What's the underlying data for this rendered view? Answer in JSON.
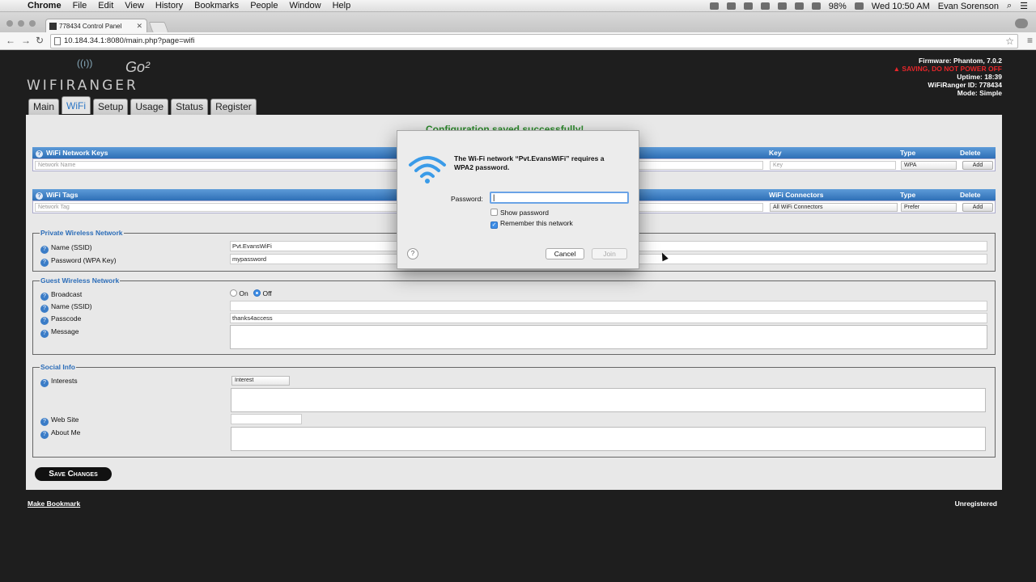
{
  "menubar": {
    "app": "Chrome",
    "items": [
      "File",
      "Edit",
      "View",
      "History",
      "Bookmarks",
      "People",
      "Window",
      "Help"
    ],
    "battery": "98%",
    "clock": "Wed 10:50 AM",
    "user": "Evan Sorenson"
  },
  "browser": {
    "tab_title": "778434 Control Panel",
    "url": "10.184.34.1:8080/main.php?page=wifi"
  },
  "header": {
    "logo_text": "WIFIRANGER",
    "logo_model": "Go²",
    "firmware": "Firmware: Phantom, 7.0.2",
    "warning": "SAVING, DO NOT POWER OFF",
    "uptime": "Uptime: 18:39",
    "ranger_id": "WiFiRanger ID: 778434",
    "mode": "Mode: Simple"
  },
  "nav": [
    "Main",
    "WiFi",
    "Setup",
    "Usage",
    "Status",
    "Register"
  ],
  "content": {
    "confirmation": "Configuration saved successfully!",
    "network_keys": {
      "title": "WiFi Network Keys",
      "col_key": "Key",
      "col_type": "Type",
      "col_delete": "Delete",
      "name_placeholder": "Network Name",
      "key_placeholder": "Key",
      "type_value": "WPA",
      "add_label": "Add"
    },
    "wifi_tags": {
      "title": "WiFi Tags",
      "col_connectors": "WiFi Connectors",
      "col_type": "Type",
      "col_delete": "Delete",
      "tag_placeholder": "Network Tag",
      "connector_value": "All WiFi Connectors",
      "type_value": "Prefer",
      "add_label": "Add"
    },
    "private": {
      "legend": "Private Wireless Network",
      "ssid_label": "Name (SSID)",
      "ssid_value": "Pvt.EvansWiFi",
      "key_label": "Password (WPA Key)",
      "key_value": "mypassword"
    },
    "guest": {
      "legend": "Guest Wireless Network",
      "broadcast_label": "Broadcast",
      "on_label": "On",
      "off_label": "Off",
      "ssid_label": "Name (SSID)",
      "passcode_label": "Passcode",
      "passcode_value": "thanks4access",
      "message_label": "Message"
    },
    "social": {
      "legend": "Social Info",
      "interests_label": "Interests",
      "interest_select": "Interest",
      "website_label": "Web Site",
      "about_label": "About Me"
    },
    "save_label": "Save Changes"
  },
  "footer": {
    "bookmark": "Make Bookmark",
    "status": "Unregistered"
  },
  "dialog": {
    "message": "The Wi-Fi network “Pvt.EvansWiFi” requires a WPA2 password.",
    "password_label": "Password:",
    "password_value": "",
    "show_password": "Show password",
    "show_password_checked": false,
    "remember": "Remember this network",
    "remember_checked": true,
    "cancel": "Cancel",
    "join": "Join",
    "help": "?"
  },
  "colors": {
    "accent": "#2e6fb6",
    "warning": "#e8262a",
    "success": "#2c8a2c"
  }
}
